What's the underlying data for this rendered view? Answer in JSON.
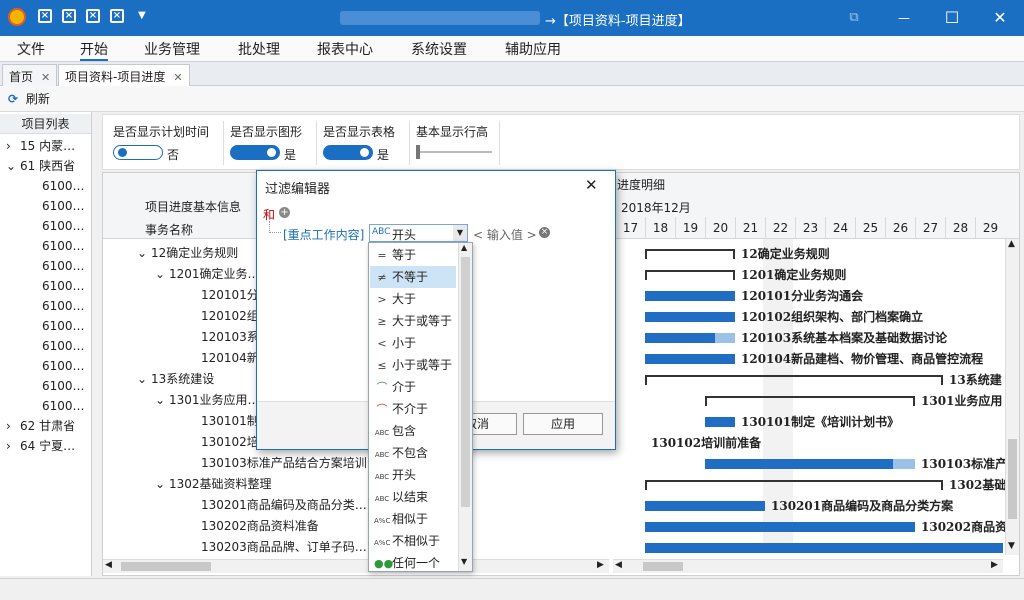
{
  "window": {
    "title_prefix": "→",
    "title": "【项目资料-项目进度】",
    "restore_glyph": "⧉",
    "minimize_glyph": "—",
    "maximize_glyph": "☐",
    "close_glyph": "✕"
  },
  "menu": [
    "文件",
    "开始",
    "业务管理",
    "批处理",
    "报表中心",
    "系统设置",
    "辅助应用"
  ],
  "tabs": [
    {
      "label": "首页"
    },
    {
      "label": "项目资料-项目进度"
    }
  ],
  "toolbar": {
    "refresh_label": "刷新"
  },
  "project_tree": {
    "header": "项目列表",
    "items": [
      {
        "label": "15 内蒙…",
        "expander": "›",
        "level": 0
      },
      {
        "label": "61 陕西省",
        "expander": "⌄",
        "level": 0
      },
      {
        "label": "6100…",
        "expander": "",
        "level": 1
      },
      {
        "label": "6100…",
        "expander": "",
        "level": 1
      },
      {
        "label": "6100…",
        "expander": "",
        "level": 1
      },
      {
        "label": "6100…",
        "expander": "",
        "level": 1
      },
      {
        "label": "6100…",
        "expander": "",
        "level": 1
      },
      {
        "label": "6100…",
        "expander": "",
        "level": 1
      },
      {
        "label": "6100…",
        "expander": "",
        "level": 1
      },
      {
        "label": "6100…",
        "expander": "",
        "level": 1
      },
      {
        "label": "6100…",
        "expander": "",
        "level": 1
      },
      {
        "label": "6100…",
        "expander": "",
        "level": 1
      },
      {
        "label": "6100…",
        "expander": "",
        "level": 1
      },
      {
        "label": "6100…",
        "expander": "",
        "level": 1
      },
      {
        "label": "62 甘肃省",
        "expander": "›",
        "level": 0
      },
      {
        "label": "64 宁夏…",
        "expander": "›",
        "level": 0
      }
    ]
  },
  "options": {
    "plan_time": {
      "label": "是否显示计划时间",
      "value": "否",
      "on": false
    },
    "graph": {
      "label": "是否显示图形",
      "value": "是",
      "on": true
    },
    "table": {
      "label": "是否显示表格",
      "value": "是",
      "on": true
    },
    "row_height": {
      "label": "基本显示行高"
    }
  },
  "grid": {
    "group_header": "项目进度基本信息",
    "detail_header": "进度明细",
    "month": "2018年12月",
    "column_header": "事务名称",
    "days": [
      "17",
      "18",
      "19",
      "20",
      "21",
      "22",
      "23",
      "24",
      "25",
      "26",
      "27",
      "28",
      "29"
    ],
    "rows": [
      {
        "name": "12确定业务规则",
        "indent": 1,
        "gantt_label": "12确定业务规则"
      },
      {
        "name": "1201确定业务…",
        "indent": 2,
        "gantt_label": "1201确定业务规则"
      },
      {
        "name": "120101分…",
        "indent": 3,
        "gantt_label": "120101分业务沟通会"
      },
      {
        "name": "120102组…",
        "indent": 3,
        "gantt_label": "120102组织架构、部门档案确立"
      },
      {
        "name": "120103系…",
        "indent": 3,
        "gantt_label": "120103系统基本档案及基础数据讨论"
      },
      {
        "name": "120104新…",
        "indent": 3,
        "gantt_label": "120104新品建档、物价管理、商品管控流程"
      },
      {
        "name": "13系统建设",
        "indent": 1,
        "gantt_label": "13系统建"
      },
      {
        "name": "1301业务应用…",
        "indent": 2,
        "gantt_label": "1301业务应用"
      },
      {
        "name": "130101制…",
        "indent": 3,
        "gantt_label": "130101制定《培训计划书》"
      },
      {
        "name": "130102培…",
        "indent": 3,
        "gantt_label": "130102培训前准备"
      },
      {
        "name": "130103标准产品结合方案培训",
        "indent": 3,
        "gantt_label": "130103标准产"
      },
      {
        "name": "1302基础资料整理",
        "indent": 2,
        "gantt_label": "1302基础"
      },
      {
        "name": "130201商品编码及商品分类…",
        "indent": 3,
        "gantt_label": "130201商品编码及商品分类方案"
      },
      {
        "name": "130202商品资料准备",
        "indent": 3,
        "gantt_label": "130202商品资"
      },
      {
        "name": "130203商品品牌、订单子码…",
        "indent": 3,
        "gantt_label": ""
      }
    ]
  },
  "filter_dialog": {
    "title": "过滤编辑器",
    "close_glyph": "✕",
    "logic": "和",
    "field": "[重点工作内容]",
    "operator": "开头",
    "value_placeholder": "< 输入值 >",
    "cancel_label": "取消",
    "apply_label": "应用"
  },
  "operator_options": [
    {
      "label": "等于",
      "glyph": "="
    },
    {
      "label": "不等于",
      "glyph": "≠",
      "selected": true
    },
    {
      "label": "大于",
      "glyph": ">"
    },
    {
      "label": "大于或等于",
      "glyph": "≥"
    },
    {
      "label": "小于",
      "glyph": "<"
    },
    {
      "label": "小于或等于",
      "glyph": "≤"
    },
    {
      "label": "介于",
      "glyph": "⌒"
    },
    {
      "label": "不介于",
      "glyph": "⌒"
    },
    {
      "label": "包含",
      "glyph": "ABC"
    },
    {
      "label": "不包含",
      "glyph": "ABC"
    },
    {
      "label": "开头",
      "glyph": "ABC"
    },
    {
      "label": "以结束",
      "glyph": "ABC"
    },
    {
      "label": "相似于",
      "glyph": "A%C"
    },
    {
      "label": "不相似于",
      "glyph": "A%C"
    },
    {
      "label": "任何一个",
      "glyph": "●●"
    }
  ],
  "colors": {
    "accent": "#1b6fc2",
    "gantt_bar": "#1f6ec4",
    "gantt_rest": "#9cc1e9"
  }
}
